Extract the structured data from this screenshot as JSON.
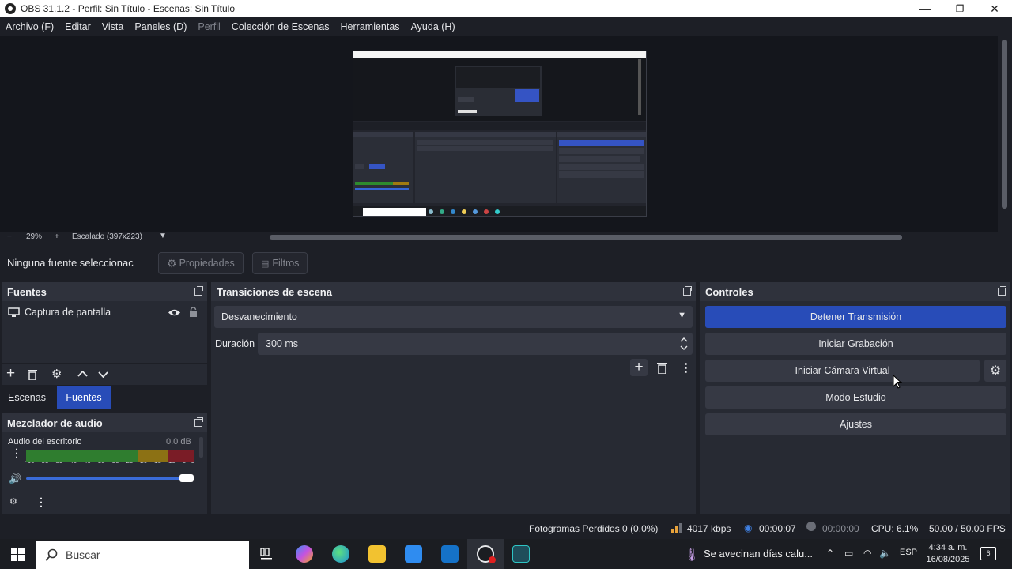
{
  "window": {
    "title": "OBS 31.1.2 - Perfil: Sin Título - Escenas: Sin Título",
    "minimize": "—",
    "maximize": "❐",
    "close": "✕"
  },
  "menu": [
    "Archivo (F)",
    "Editar",
    "Vista",
    "Paneles (D)",
    "Perfil",
    "Colección de Escenas",
    "Herramientas",
    "Ayuda (H)"
  ],
  "preview": {
    "zoom_minus": "−",
    "zoom": "29%",
    "zoom_plus": "+",
    "scaling": "Escalado (397x223)"
  },
  "properties_bar": {
    "no_source": "Ninguna fuente seleccionac",
    "properties": "Propiedades",
    "filters": "Filtros"
  },
  "sources": {
    "title": "Fuentes",
    "items": [
      {
        "label": "Captura de pantalla",
        "visible": true,
        "locked": false
      }
    ]
  },
  "tabs": {
    "scenes": "Escenas",
    "sources": "Fuentes",
    "active": "Fuentes"
  },
  "mixer": {
    "title": "Mezclador de audio",
    "channel": "Audio del escritorio",
    "level": "0.0 dB",
    "scale": [
      "-60",
      "-55",
      "-50",
      "-45",
      "-40",
      "-35",
      "-30",
      "-25",
      "-20",
      "-15",
      "-10",
      "-5",
      "0"
    ],
    "volume": 1.0
  },
  "transitions": {
    "title": "Transiciones de escena",
    "selected": "Desvanecimiento",
    "duration_label": "Duración",
    "duration_value": "300 ms"
  },
  "controls": {
    "title": "Controles",
    "stop_stream": "Detener Transmisión",
    "start_recording": "Iniciar Grabación",
    "start_virtual_cam": "Iniciar Cámara Virtual",
    "studio_mode": "Modo Estudio",
    "settings": "Ajustes"
  },
  "status": {
    "dropped": "Fotogramas Perdidos 0 (0.0%)",
    "bitrate": "4017 kbps",
    "stream_time": "00:00:07",
    "rec_time": "00:00:00",
    "cpu": "CPU: 6.1%",
    "fps": "50.00 / 50.00 FPS"
  },
  "taskbar": {
    "search_placeholder": "Buscar",
    "weather": "Se avecinan días calu...",
    "lang": "ESP",
    "time": "4:34 a. m.",
    "date": "16/08/2025",
    "notif_count": "6"
  },
  "colors": {
    "accent": "#284cb8",
    "dock": "#272a33",
    "background": "#1d1f26"
  }
}
